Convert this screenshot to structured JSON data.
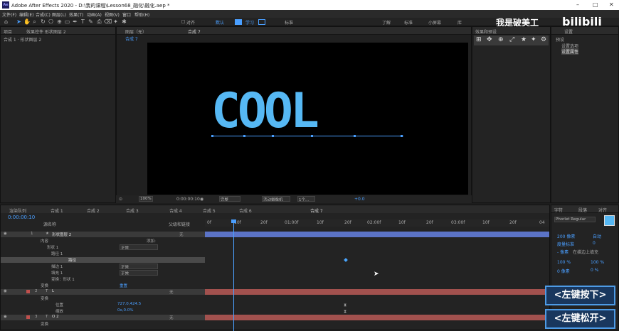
{
  "title_bar": {
    "logo": "Ae",
    "title": "Adobe After Effects 2020 - D:\\我的课程\\Lesson68_融化\\融化.aep *",
    "minimize": "–",
    "maximize": "□",
    "close": "✕"
  },
  "menu": [
    "文件(F)",
    "编辑(E)",
    "合成(C)",
    "图层(L)",
    "效果(T)",
    "动画(A)",
    "视图(V)",
    "窗口",
    "帮助(H)"
  ],
  "toolbar": {
    "snap_label": "对齐",
    "workspaces": [
      "默认",
      "学习",
      "标准",
      "小屏幕",
      "库"
    ],
    "active_ws1": "基本",
    "active_ws2": "动画",
    "extra_ws": [
      "了解",
      "标准",
      "小屏幕"
    ],
    "watermark": "我是破美工_"
  },
  "project_panel": {
    "tab1": "项目",
    "tab2": "效果控件 形状图层 2",
    "sub": "合成 1 · 形状图层 2"
  },
  "comp_panel": {
    "tab_prefix": "图层（无）",
    "tab": "合成 7",
    "breadcrumb": "合成 7",
    "content_text": "COOL"
  },
  "viewer_bar": {
    "zoom": "100%",
    "timecode": "0:00:00:10",
    "quality": "完整",
    "camera": "活动摄像机",
    "views": "1个...",
    "exposure": "+0.0"
  },
  "effects_panel": {
    "tab": "效果和预设",
    "info_title": "设置",
    "items": [
      "预设",
      "设置选项",
      "设置属性"
    ]
  },
  "timeline": {
    "tabs": [
      "渲染队列",
      "合成 1",
      "合成 2",
      "合成 3",
      "合成 4",
      "合成 5",
      "合成 6",
      "合成 7"
    ],
    "timecode": "0:00:00:10",
    "header_labels": {
      "name": "源名称",
      "parent": "父级和链接"
    },
    "ruler": [
      "0f",
      "10f",
      "20f",
      "01:00f",
      "10f",
      "20f",
      "02:00f",
      "10f",
      "20f",
      "03:00f",
      "10f",
      "20f",
      "04"
    ],
    "rows": [
      {
        "num": "1",
        "name": "形状图层 2",
        "mode": "无",
        "type": "layer",
        "star": "★"
      },
      {
        "name": "内容",
        "right": "添加:"
      },
      {
        "name": "形状 1",
        "mode": "正常"
      },
      {
        "name": "路径 1"
      },
      {
        "name": "路径"
      },
      {
        "name": "描边 1",
        "mode": "正常"
      },
      {
        "name": "填充 1",
        "mode": "正常"
      },
      {
        "name": "变换：形状 1"
      },
      {
        "name": "变换",
        "right": "重置"
      },
      {
        "num": "2",
        "name": "L",
        "mode": "无",
        "type": "text"
      },
      {
        "name": "变换"
      },
      {
        "name": "位置",
        "value": "727.0,424.5"
      },
      {
        "name": "缩放",
        "value": "0x,0.0%"
      },
      {
        "num": "3",
        "name": "O 2",
        "mode": "无",
        "type": "text"
      },
      {
        "name": "变换"
      }
    ]
  },
  "char_panel": {
    "tab1": "字符",
    "tab2": "段落",
    "tab3": "对齐",
    "font": "Phorlet Regular",
    "size": "200 像素",
    "leading": "自动",
    "kerning": "度量标准",
    "tracking": "0",
    "stroke": "- 像素",
    "stroke_mode": "在描边上填充",
    "vscale": "100 %",
    "hscale": "100 %",
    "baseline": "0 像素",
    "tsume": "0 %"
  },
  "overlay": {
    "press": "<左键按下>",
    "release": "<左键松开>"
  },
  "colors": {
    "accent": "#56b8f4",
    "layer_red": "#a2514e",
    "layer_blue": "#5b73c6",
    "keyframe": "#4aa6ff"
  }
}
